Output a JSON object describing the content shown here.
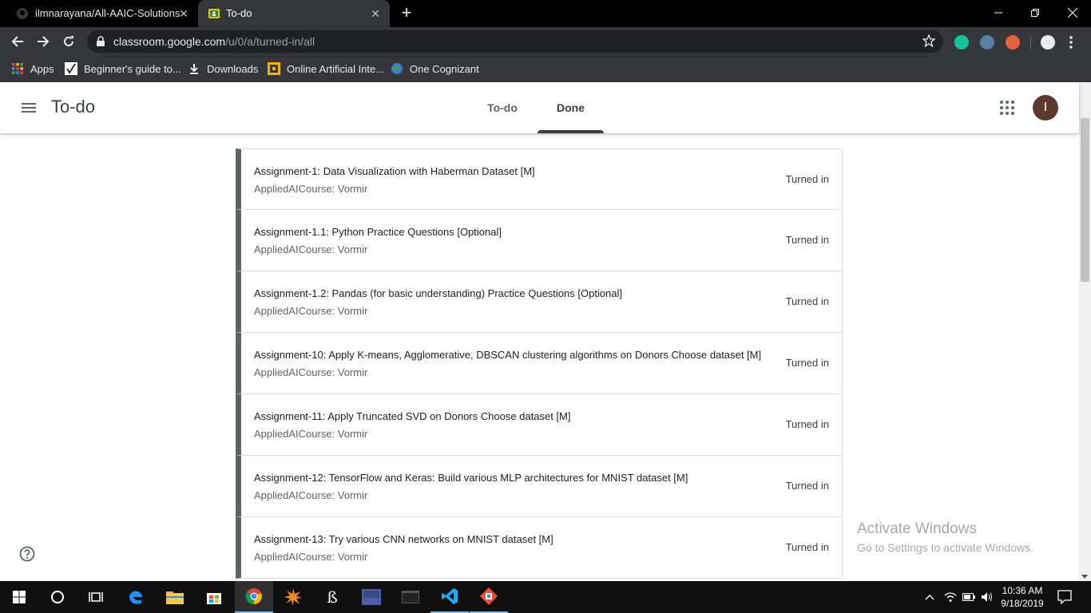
{
  "browser": {
    "tabs": [
      {
        "title": "ilmnarayana/All-AAIC-Solutions",
        "active": false,
        "icon": "github-icon"
      },
      {
        "title": "To-do",
        "active": true,
        "icon": "classroom-icon"
      }
    ],
    "url_host": "classroom.google.com",
    "url_path": "/u/0/a/turned-in/all",
    "bookmarks": [
      {
        "label": "Apps",
        "icon": "apps-grid-icon"
      },
      {
        "label": "Beginner's guide to...",
        "icon": "checkmark-icon"
      },
      {
        "label": "Downloads",
        "icon": "download-icon"
      },
      {
        "label": "Online Artificial Inte...",
        "icon": "aai-icon"
      },
      {
        "label": "One Cognizant",
        "icon": "globe-icon"
      }
    ]
  },
  "app": {
    "title": "To-do",
    "tabs": [
      {
        "label": "To-do",
        "selected": false
      },
      {
        "label": "Done",
        "selected": true
      }
    ],
    "avatar_initial": "I"
  },
  "assignments": [
    {
      "name": "Assignment-1: Data Visualization with Haberman Dataset [M]",
      "course": "AppliedAICourse: Vormir",
      "status": "Turned in"
    },
    {
      "name": "Assignment-1.1: Python Practice Questions [Optional]",
      "course": "AppliedAICourse: Vormir",
      "status": "Turned in"
    },
    {
      "name": "Assignment-1.2: Pandas (for basic understanding) Practice Questions [Optional]",
      "course": "AppliedAICourse: Vormir",
      "status": "Turned in"
    },
    {
      "name": "Assignment-10: Apply K-means, Agglomerative, DBSCAN clustering algorithms on Donors Choose dataset [M]",
      "course": "AppliedAICourse: Vormir",
      "status": "Turned in"
    },
    {
      "name": "Assignment-11: Apply Truncated SVD on Donors Choose dataset [M]",
      "course": "AppliedAICourse: Vormir",
      "status": "Turned in"
    },
    {
      "name": "Assignment-12: TensorFlow and Keras: Build various MLP architectures for MNIST dataset [M]",
      "course": "AppliedAICourse: Vormir",
      "status": "Turned in"
    },
    {
      "name": "Assignment-13: Try various CNN networks on MNIST dataset [M]",
      "course": "AppliedAICourse: Vormir",
      "status": "Turned in"
    }
  ],
  "watermark": {
    "line1": "Activate Windows",
    "line2": "Go to Settings to activate Windows."
  },
  "taskbar": {
    "time": "10:36 AM",
    "date": "9/18/2019"
  },
  "colors": {
    "chrome_dark": "#35363a",
    "assignment_accent": "#5f6368",
    "avatar": "#5d3a2d"
  }
}
